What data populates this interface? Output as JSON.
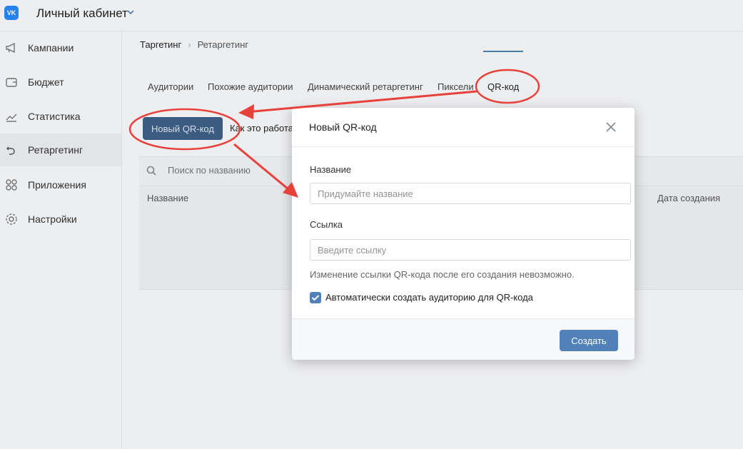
{
  "header": {
    "logo_text": "VK",
    "title": "Личный кабинет"
  },
  "sidebar": {
    "items": [
      {
        "label": "Кампании",
        "icon": "megaphone-icon"
      },
      {
        "label": "Бюджет",
        "icon": "wallet-icon"
      },
      {
        "label": "Статистика",
        "icon": "stats-icon"
      },
      {
        "label": "Ретаргетинг",
        "icon": "retarget-icon",
        "active": true
      },
      {
        "label": "Приложения",
        "icon": "apps-icon"
      },
      {
        "label": "Настройки",
        "icon": "gear-icon"
      }
    ]
  },
  "breadcrumb": {
    "root": "Таргетинг",
    "current": "Ретаргетинг",
    "separator": "›"
  },
  "tabs": [
    {
      "label": "Аудитории"
    },
    {
      "label": "Похожие аудитории"
    },
    {
      "label": "Динамический ретаргетинг"
    },
    {
      "label": "Пиксели"
    },
    {
      "label": "QR-код",
      "active": true
    }
  ],
  "toolbar": {
    "new_button": "Новый QR-код",
    "how_link": "Как это работает"
  },
  "search": {
    "placeholder": "Поиск по названию"
  },
  "table": {
    "columns": [
      "Название",
      "Дата создания"
    ]
  },
  "modal": {
    "title": "Новый QR-код",
    "name_label": "Название",
    "name_placeholder": "Придумайте название",
    "link_label": "Ссылка",
    "link_placeholder": "Введите ссылку",
    "hint": "Изменение ссылки QR-кода после его создания невозможно.",
    "checkbox_label": "Автоматически создать аудиторию для QR-кода",
    "checkbox_checked": true,
    "submit": "Создать"
  },
  "colors": {
    "accent": "#5181b8",
    "annotation": "#e8403a",
    "primary_dark": "#3f5f86"
  }
}
